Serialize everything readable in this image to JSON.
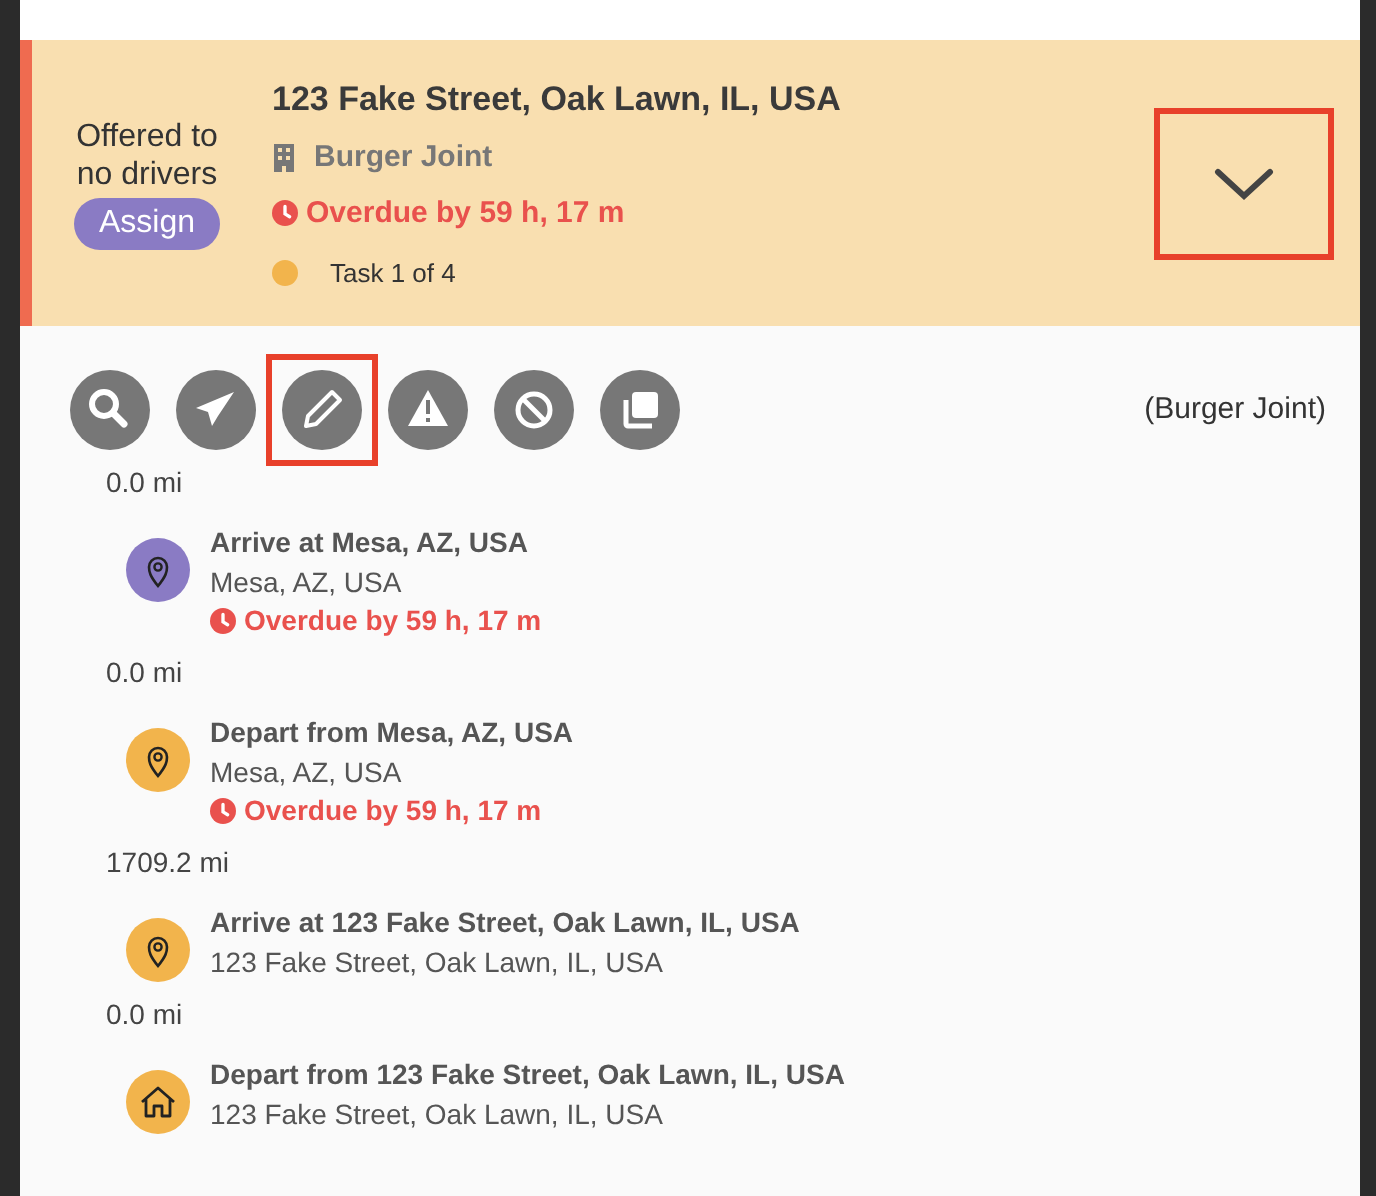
{
  "task": {
    "offer_status": "Offered to no drivers",
    "assign_button": "Assign",
    "title": "123 Fake Street, Oak Lawn, IL, USA",
    "merchant": "Burger Joint",
    "overdue": "Overdue by 59 h, 17 m",
    "task_count": "Task 1 of 4",
    "status_dot": {
      "color": "#f2b44c"
    },
    "expand_highlighted": true
  },
  "actions": [
    {
      "kind": "search",
      "highlighted": false
    },
    {
      "kind": "send",
      "highlighted": false
    },
    {
      "kind": "edit",
      "highlighted": true
    },
    {
      "kind": "warning",
      "highlighted": false
    },
    {
      "kind": "cancel",
      "highlighted": false
    },
    {
      "kind": "duplicate",
      "highlighted": false
    }
  ],
  "merchant_note": "(Burger Joint)",
  "stops": [
    {
      "distance": "0.0 mi",
      "kind": "pin",
      "color": "#8a7bc4",
      "title": "Arrive at Mesa, AZ, USA",
      "address": "Mesa, AZ, USA",
      "overdue": "Overdue by 59 h, 17 m"
    },
    {
      "distance": "0.0 mi",
      "kind": "pin",
      "color": "#f2b44c",
      "title": "Depart from Mesa, AZ, USA",
      "address": "Mesa, AZ, USA",
      "overdue": "Overdue by 59 h, 17 m"
    },
    {
      "distance": "1709.2 mi",
      "kind": "pin",
      "color": "#f2b44c",
      "title": "Arrive at 123 Fake Street, Oak Lawn, IL, USA",
      "address": "123 Fake Street, Oak Lawn, IL, USA"
    },
    {
      "distance": "0.0 mi",
      "kind": "home",
      "color": "#f2b44c",
      "title": "Depart from 123 Fake Street, Oak Lawn, IL, USA",
      "address": "123 Fake Street, Oak Lawn, IL, USA"
    }
  ]
}
